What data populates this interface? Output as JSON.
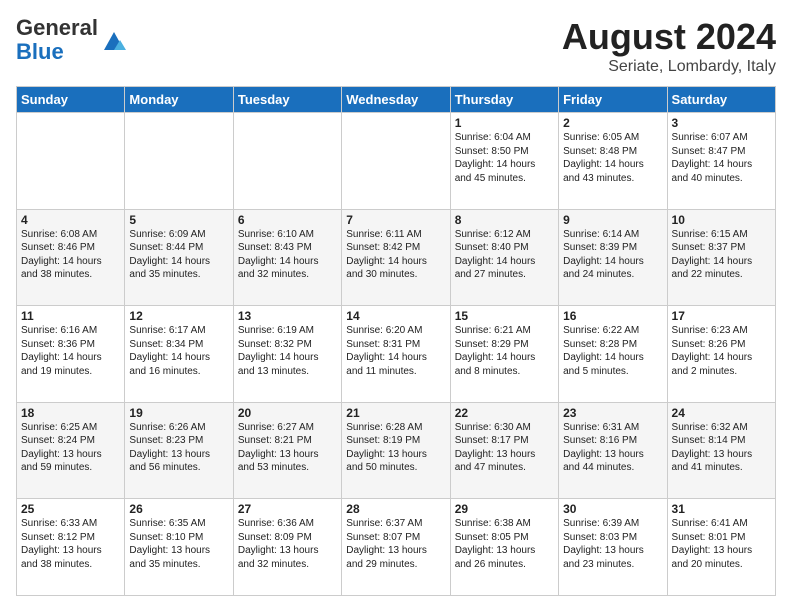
{
  "header": {
    "logo_general": "General",
    "logo_blue": "Blue",
    "month_year": "August 2024",
    "location": "Seriate, Lombardy, Italy"
  },
  "weekdays": [
    "Sunday",
    "Monday",
    "Tuesday",
    "Wednesday",
    "Thursday",
    "Friday",
    "Saturday"
  ],
  "weeks": [
    [
      {
        "day": "",
        "info": ""
      },
      {
        "day": "",
        "info": ""
      },
      {
        "day": "",
        "info": ""
      },
      {
        "day": "",
        "info": ""
      },
      {
        "day": "1",
        "info": "Sunrise: 6:04 AM\nSunset: 8:50 PM\nDaylight: 14 hours\nand 45 minutes."
      },
      {
        "day": "2",
        "info": "Sunrise: 6:05 AM\nSunset: 8:48 PM\nDaylight: 14 hours\nand 43 minutes."
      },
      {
        "day": "3",
        "info": "Sunrise: 6:07 AM\nSunset: 8:47 PM\nDaylight: 14 hours\nand 40 minutes."
      }
    ],
    [
      {
        "day": "4",
        "info": "Sunrise: 6:08 AM\nSunset: 8:46 PM\nDaylight: 14 hours\nand 38 minutes."
      },
      {
        "day": "5",
        "info": "Sunrise: 6:09 AM\nSunset: 8:44 PM\nDaylight: 14 hours\nand 35 minutes."
      },
      {
        "day": "6",
        "info": "Sunrise: 6:10 AM\nSunset: 8:43 PM\nDaylight: 14 hours\nand 32 minutes."
      },
      {
        "day": "7",
        "info": "Sunrise: 6:11 AM\nSunset: 8:42 PM\nDaylight: 14 hours\nand 30 minutes."
      },
      {
        "day": "8",
        "info": "Sunrise: 6:12 AM\nSunset: 8:40 PM\nDaylight: 14 hours\nand 27 minutes."
      },
      {
        "day": "9",
        "info": "Sunrise: 6:14 AM\nSunset: 8:39 PM\nDaylight: 14 hours\nand 24 minutes."
      },
      {
        "day": "10",
        "info": "Sunrise: 6:15 AM\nSunset: 8:37 PM\nDaylight: 14 hours\nand 22 minutes."
      }
    ],
    [
      {
        "day": "11",
        "info": "Sunrise: 6:16 AM\nSunset: 8:36 PM\nDaylight: 14 hours\nand 19 minutes."
      },
      {
        "day": "12",
        "info": "Sunrise: 6:17 AM\nSunset: 8:34 PM\nDaylight: 14 hours\nand 16 minutes."
      },
      {
        "day": "13",
        "info": "Sunrise: 6:19 AM\nSunset: 8:32 PM\nDaylight: 14 hours\nand 13 minutes."
      },
      {
        "day": "14",
        "info": "Sunrise: 6:20 AM\nSunset: 8:31 PM\nDaylight: 14 hours\nand 11 minutes."
      },
      {
        "day": "15",
        "info": "Sunrise: 6:21 AM\nSunset: 8:29 PM\nDaylight: 14 hours\nand 8 minutes."
      },
      {
        "day": "16",
        "info": "Sunrise: 6:22 AM\nSunset: 8:28 PM\nDaylight: 14 hours\nand 5 minutes."
      },
      {
        "day": "17",
        "info": "Sunrise: 6:23 AM\nSunset: 8:26 PM\nDaylight: 14 hours\nand 2 minutes."
      }
    ],
    [
      {
        "day": "18",
        "info": "Sunrise: 6:25 AM\nSunset: 8:24 PM\nDaylight: 13 hours\nand 59 minutes."
      },
      {
        "day": "19",
        "info": "Sunrise: 6:26 AM\nSunset: 8:23 PM\nDaylight: 13 hours\nand 56 minutes."
      },
      {
        "day": "20",
        "info": "Sunrise: 6:27 AM\nSunset: 8:21 PM\nDaylight: 13 hours\nand 53 minutes."
      },
      {
        "day": "21",
        "info": "Sunrise: 6:28 AM\nSunset: 8:19 PM\nDaylight: 13 hours\nand 50 minutes."
      },
      {
        "day": "22",
        "info": "Sunrise: 6:30 AM\nSunset: 8:17 PM\nDaylight: 13 hours\nand 47 minutes."
      },
      {
        "day": "23",
        "info": "Sunrise: 6:31 AM\nSunset: 8:16 PM\nDaylight: 13 hours\nand 44 minutes."
      },
      {
        "day": "24",
        "info": "Sunrise: 6:32 AM\nSunset: 8:14 PM\nDaylight: 13 hours\nand 41 minutes."
      }
    ],
    [
      {
        "day": "25",
        "info": "Sunrise: 6:33 AM\nSunset: 8:12 PM\nDaylight: 13 hours\nand 38 minutes."
      },
      {
        "day": "26",
        "info": "Sunrise: 6:35 AM\nSunset: 8:10 PM\nDaylight: 13 hours\nand 35 minutes."
      },
      {
        "day": "27",
        "info": "Sunrise: 6:36 AM\nSunset: 8:09 PM\nDaylight: 13 hours\nand 32 minutes."
      },
      {
        "day": "28",
        "info": "Sunrise: 6:37 AM\nSunset: 8:07 PM\nDaylight: 13 hours\nand 29 minutes."
      },
      {
        "day": "29",
        "info": "Sunrise: 6:38 AM\nSunset: 8:05 PM\nDaylight: 13 hours\nand 26 minutes."
      },
      {
        "day": "30",
        "info": "Sunrise: 6:39 AM\nSunset: 8:03 PM\nDaylight: 13 hours\nand 23 minutes."
      },
      {
        "day": "31",
        "info": "Sunrise: 6:41 AM\nSunset: 8:01 PM\nDaylight: 13 hours\nand 20 minutes."
      }
    ]
  ]
}
